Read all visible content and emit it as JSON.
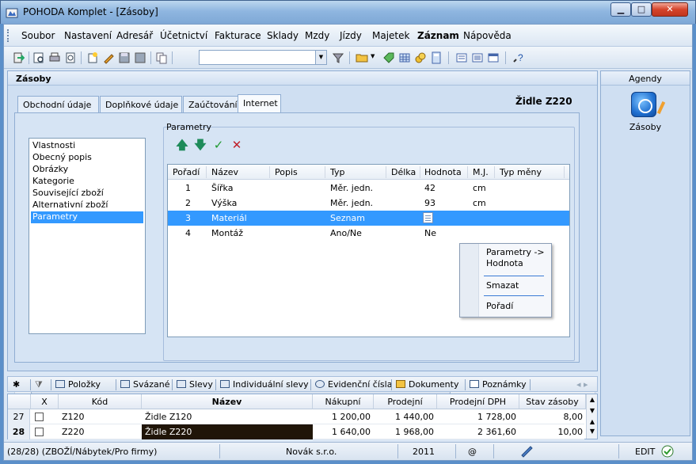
{
  "window": {
    "title": "POHODA Komplet - [Zásoby]"
  },
  "menu": [
    "Soubor",
    "Nastavení",
    "Adresář",
    "Účetnictví",
    "Fakturace",
    "Sklady",
    "Mzdy",
    "Jízdy",
    "Majetek",
    "Záznam",
    "Nápověda"
  ],
  "toolbar": {
    "combo_value": ""
  },
  "panel": {
    "title": "Zásoby",
    "product_name": "Židle Z220",
    "tabs": [
      "Obchodní údaje",
      "Doplňkové údaje",
      "Zaúčtování",
      "Internet"
    ],
    "active_tab": "Internet",
    "sections": [
      "Vlastnosti",
      "Obecný popis",
      "Obrázky",
      "Kategorie",
      "Související zboží",
      "Alternativní zboží",
      "Parametry"
    ],
    "selected_section": "Parametry",
    "param_group_label": "Parametry"
  },
  "params_table": {
    "columns": [
      "Pořadí",
      "Název",
      "Popis",
      "Typ",
      "Délka",
      "Hodnota",
      "M.J.",
      "Typ měny"
    ],
    "rows": [
      {
        "order": "1",
        "name": "Šířka",
        "desc": "",
        "type": "Měr. jedn.",
        "length": "",
        "value": "42",
        "unit": "cm",
        "currency": ""
      },
      {
        "order": "2",
        "name": "Výška",
        "desc": "",
        "type": "Měr. jedn.",
        "length": "",
        "value": "93",
        "unit": "cm",
        "currency": ""
      },
      {
        "order": "3",
        "name": "Materiál",
        "desc": "",
        "type": "Seznam",
        "length": "",
        "value": "",
        "unit": "",
        "currency": ""
      },
      {
        "order": "4",
        "name": "Montáž",
        "desc": "",
        "type": "Ano/Ne",
        "length": "",
        "value": "Ne",
        "unit": "",
        "currency": ""
      }
    ],
    "selected_row": 2
  },
  "context_menu": {
    "item1_line1": "Parametry ->",
    "item1_line2": "Hodnota",
    "item2": "Smazat",
    "item3": "Pořadí"
  },
  "agendy": {
    "title": "Agendy",
    "item": "Zásoby"
  },
  "bottom_tabs": [
    "Položky",
    "Svázané",
    "Slevy",
    "Individuální slevy",
    "Evidenční čísla",
    "Dokumenty",
    "Poznámky"
  ],
  "grid": {
    "columns": [
      "X",
      "Kód",
      "Název",
      "Nákupní",
      "Prodejní",
      "Prodejní DPH",
      "Stav zásoby"
    ],
    "rows": [
      {
        "num": "27",
        "code": "Z120",
        "name": "Židle Z120",
        "buy": "1 200,00",
        "sell": "1 440,00",
        "sell_vat": "1 728,00",
        "stock": "8,00"
      },
      {
        "num": "28",
        "code": "Z220",
        "name": "Židle Z220",
        "buy": "1 640,00",
        "sell": "1 968,00",
        "sell_vat": "2 361,60",
        "stock": "10,00"
      }
    ]
  },
  "status": {
    "record": "(28/28) (ZBOŽÍ/Nábytek/Pro firmy)",
    "user": "Novák s.r.o.",
    "year": "2011",
    "at": "@",
    "mode": "EDIT"
  },
  "colors": {
    "selection": "#3399ff",
    "frame": "#dbe7f5",
    "title_gradient": "#8fb6e0"
  }
}
